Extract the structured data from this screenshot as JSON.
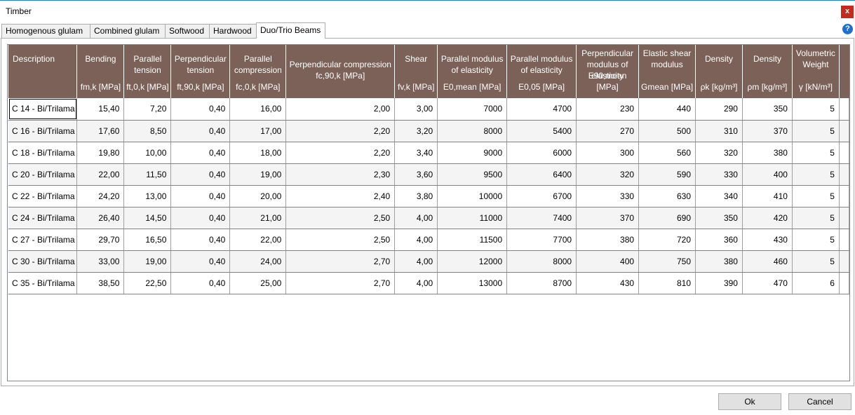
{
  "window": {
    "title": "Timber",
    "close_glyph": "x",
    "help_glyph": "?"
  },
  "tabs": [
    {
      "label": "Homogenous glulam"
    },
    {
      "label": "Combined glulam"
    },
    {
      "label": "Softwood"
    },
    {
      "label": "Hardwood"
    },
    {
      "label": "Duo/Trio Beams",
      "active": true
    }
  ],
  "columns": [
    {
      "label": "Description",
      "symbol": ""
    },
    {
      "label": "Bending",
      "symbol": "fm,k [MPa]"
    },
    {
      "label": "Parallel tension",
      "symbol": "ft,0,k [MPa]"
    },
    {
      "label": "Perpendicular tension",
      "symbol": "ft,90,k [MPa]"
    },
    {
      "label": "Parallel compression",
      "symbol": "fc,0,k [MPa]"
    },
    {
      "label": "Perpendicular compression",
      "symbol": "fc,90,k [MPa]"
    },
    {
      "label": "Shear",
      "symbol": "fv,k [MPa]"
    },
    {
      "label": "Parallel modulus of elasticity",
      "symbol": "E0,mean [MPa]"
    },
    {
      "label": "Parallel modulus of elasticity",
      "symbol": "E0,05 [MPa]"
    },
    {
      "label": "Perpendicular modulus of elasticity",
      "symbol": "E90,mean [MPa]"
    },
    {
      "label": "Elastic shear modulus",
      "symbol": "Gmean [MPa]"
    },
    {
      "label": "Density",
      "symbol": "ρk [kg/m³]"
    },
    {
      "label": "Density",
      "symbol": "ρm [kg/m³]"
    },
    {
      "label": "Volumetric Weight",
      "symbol": "γ [kN/m³]"
    }
  ],
  "rows": [
    [
      "C 14 - Bi/Trilama",
      "15,40",
      "7,20",
      "0,40",
      "16,00",
      "2,00",
      "3,00",
      "7000",
      "4700",
      "230",
      "440",
      "290",
      "350",
      "5"
    ],
    [
      "C 16 - Bi/Trilama",
      "17,60",
      "8,50",
      "0,40",
      "17,00",
      "2,20",
      "3,20",
      "8000",
      "5400",
      "270",
      "500",
      "310",
      "370",
      "5"
    ],
    [
      "C 18 - Bi/Trilama",
      "19,80",
      "10,00",
      "0,40",
      "18,00",
      "2,20",
      "3,40",
      "9000",
      "6000",
      "300",
      "560",
      "320",
      "380",
      "5"
    ],
    [
      "C 20 - Bi/Trilama",
      "22,00",
      "11,50",
      "0,40",
      "19,00",
      "2,30",
      "3,60",
      "9500",
      "6400",
      "320",
      "590",
      "330",
      "400",
      "5"
    ],
    [
      "C 22 - Bi/Trilama",
      "24,20",
      "13,00",
      "0,40",
      "20,00",
      "2,40",
      "3,80",
      "10000",
      "6700",
      "330",
      "630",
      "340",
      "410",
      "5"
    ],
    [
      "C 24 - Bi/Trilama",
      "26,40",
      "14,50",
      "0,40",
      "21,00",
      "2,50",
      "4,00",
      "11000",
      "7400",
      "370",
      "690",
      "350",
      "420",
      "5"
    ],
    [
      "C 27 - Bi/Trilama",
      "29,70",
      "16,50",
      "0,40",
      "22,00",
      "2,50",
      "4,00",
      "11500",
      "7700",
      "380",
      "720",
      "360",
      "430",
      "5"
    ],
    [
      "C 30 - Bi/Trilama",
      "33,00",
      "19,00",
      "0,40",
      "24,00",
      "2,70",
      "4,00",
      "12000",
      "8000",
      "400",
      "750",
      "380",
      "460",
      "5"
    ],
    [
      "C 35 - Bi/Trilama",
      "38,50",
      "22,50",
      "0,40",
      "25,00",
      "2,70",
      "4,00",
      "13000",
      "8700",
      "430",
      "810",
      "390",
      "470",
      "6"
    ]
  ],
  "buttons": {
    "ok": "Ok",
    "cancel": "Cancel"
  },
  "colors": {
    "header_bg": "#7b6157",
    "close_bg": "#c42b1c",
    "help_bg": "#1e6fd0"
  }
}
